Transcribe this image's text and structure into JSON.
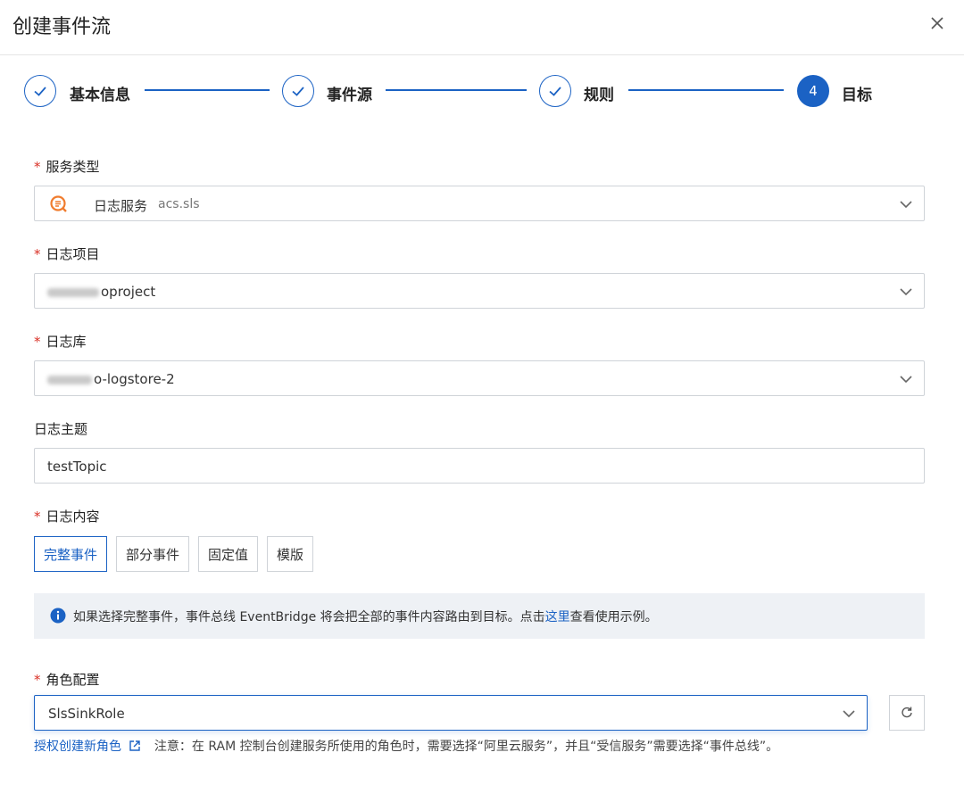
{
  "dialog": {
    "title": "创建事件流"
  },
  "steps": [
    {
      "label": "基本信息",
      "status": "done"
    },
    {
      "label": "事件源",
      "status": "done"
    },
    {
      "label": "规则",
      "status": "done"
    },
    {
      "label": "目标",
      "status": "active",
      "number": "4"
    }
  ],
  "form": {
    "service_type": {
      "label": "服务类型",
      "required": true,
      "value_name": "日志服务",
      "value_code": "acs.sls"
    },
    "log_project": {
      "label": "日志项目",
      "required": true,
      "value_suffix": "oproject"
    },
    "log_store": {
      "label": "日志库",
      "required": true,
      "value_suffix": "o-logstore-2"
    },
    "log_topic": {
      "label": "日志主题",
      "required": false,
      "value": "testTopic"
    },
    "log_content": {
      "label": "日志内容",
      "required": true,
      "options": [
        "完整事件",
        "部分事件",
        "固定值",
        "模版"
      ],
      "selected": "完整事件"
    },
    "info": {
      "text": "如果选择完整事件，事件总线 EventBridge 将会把全部的事件内容路由到目标。点击",
      "link": "这里",
      "suffix": "查看使用示例。"
    },
    "role": {
      "label": "角色配置",
      "required": true,
      "value": "SlsSinkRole",
      "create_link": "授权创建新角色",
      "note": "注意：在 RAM 控制台创建服务所使用的角色时，需要选择“阿里云服务”，并且“受信服务”需要选择“事件总线”。"
    }
  },
  "colors": {
    "primary": "#1b62c4",
    "required": "#d93026",
    "sls_icon": "#f07c2e"
  }
}
